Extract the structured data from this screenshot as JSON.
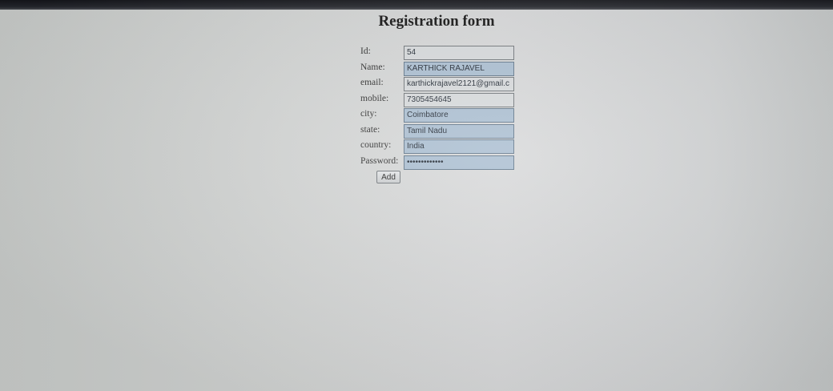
{
  "form": {
    "title": "Registration form",
    "fields": [
      {
        "label": "Id:",
        "value": "54",
        "autofilled": false
      },
      {
        "label": "Name:",
        "value": "KARTHICK RAJAVEL",
        "autofilled": true
      },
      {
        "label": "email:",
        "value": "karthickrajavel2121@gmail.c",
        "autofilled": false
      },
      {
        "label": "mobile:",
        "value": "7305454645",
        "autofilled": false
      },
      {
        "label": "city:",
        "value": "Coimbatore",
        "autofilled": true
      },
      {
        "label": "state:",
        "value": "Tamil Nadu",
        "autofilled": true
      },
      {
        "label": "country:",
        "value": "India",
        "autofilled": true
      },
      {
        "label": "Password:",
        "value": "•••••••••••••",
        "autofilled": true
      }
    ],
    "submit_label": "Add"
  },
  "colors": {
    "autofill_background": "#a9bdd0",
    "input_background": "#d6d9db"
  }
}
